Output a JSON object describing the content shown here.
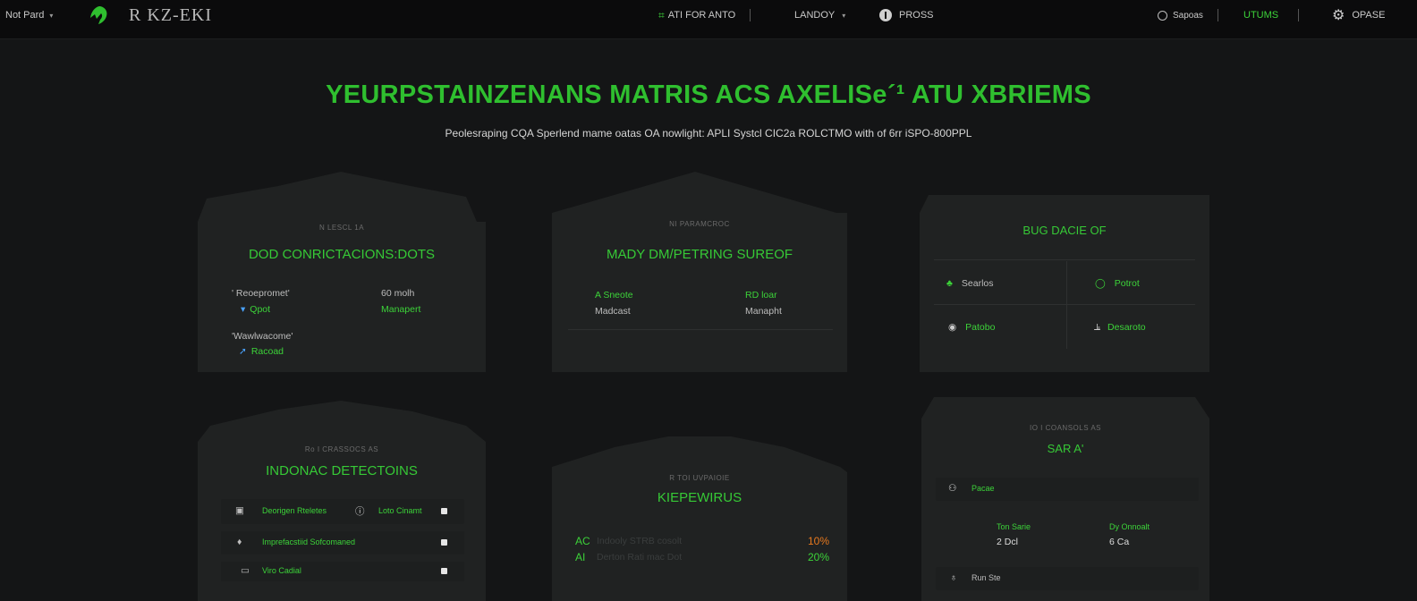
{
  "topbar": {
    "account_label": "Not Pard",
    "logo_text": "R KZ-EKI",
    "nav_auto": "ATI FOR ANTO",
    "nav_landoy": "LANDOY",
    "nav_pross": "PROSS",
    "search_label": "Sapoas",
    "utums": "UTUMS",
    "opase": "OPASE"
  },
  "hero": {
    "title": "YEURPSTAINZENANS MATRIS ACS AXELISe´¹ ATU XBRIEMS",
    "subtitle": "Peolesraping CQA Sperlend mame oatas OA nowlight: APLI Systcl CIC2a ROLCTMO with of 6rr iSPO-800PPL"
  },
  "card1": {
    "eyebrow": "N LESCL 1A",
    "title": "DOD CONRICTACIONS:DOTS",
    "left1_label": "' Reoepromet'",
    "left1_value": "Qpot",
    "right1_label": "60 molh",
    "right1_value": "Manapert",
    "left2_label": "'Wawlwacome'",
    "left2_value": "Racoad"
  },
  "card2": {
    "eyebrow": "NI PARAMCROC",
    "title": "MADY DM/PETRING SUREOF",
    "left_label": "A Sneote",
    "left_value": "Madcast",
    "right_label": "RD loar",
    "right_value": "Manapht"
  },
  "card3": {
    "title": "BUG DACIE OF",
    "items": [
      {
        "label": "Searlos"
      },
      {
        "label": "Potrot"
      },
      {
        "label": "Patobo"
      },
      {
        "label": "Desaroto"
      }
    ]
  },
  "card4": {
    "eyebrow": "Ro I CRASSOCS AS",
    "title": "INDONAC DETECTOINS",
    "rows": [
      {
        "label": "Deorigen Rteletes",
        "label2": "Loto Cinamt"
      },
      {
        "label": "Imprefacstiid Sofcomaned"
      },
      {
        "label": "Viro Cadial"
      }
    ]
  },
  "card5": {
    "eyebrow": "R TOI UVPAIOIE",
    "title": "KIEPEWIRUS",
    "rows": [
      {
        "code": "AC",
        "text": "Indooly STRB cosolt",
        "value": "10%"
      },
      {
        "code": "AI",
        "text": "Derton Rati mac Dot",
        "value": "20%"
      }
    ]
  },
  "card6": {
    "eyebrow": "IO I COANSOLS AS",
    "title": "SAR A'",
    "row1_label": "Pacae",
    "left_label": "Ton Sarie",
    "left_value": "2 Dcl",
    "right_label": "Dy Onnoalt",
    "right_value": "6 Ca",
    "row2_label": "Run Ste"
  },
  "colors": {
    "accent": "#3cd339",
    "background": "#141516",
    "card": "#202222",
    "warning": "#e7791f"
  }
}
